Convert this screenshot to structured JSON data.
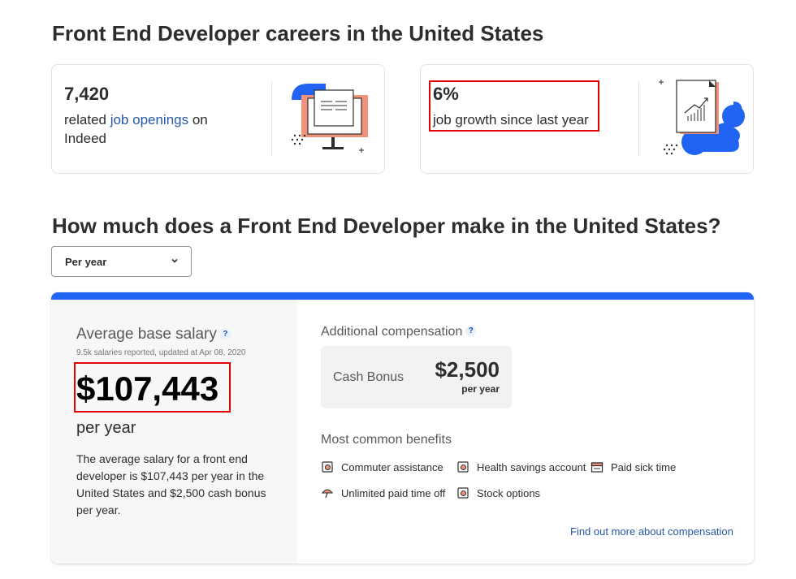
{
  "careers": {
    "title": "Front End Developer careers in the United States",
    "openings": {
      "value": "7,420",
      "text_before": "related ",
      "link": "job openings",
      "text_after": " on Indeed"
    },
    "growth": {
      "value": "6%",
      "text": "job growth since last year"
    }
  },
  "salary_section": {
    "title": "How much does a Front End Developer make in the United States?",
    "period_select": "Per year",
    "average": {
      "label": "Average base salary",
      "help": "?",
      "reported": "9.5k salaries reported, updated at Apr 08, 2020",
      "amount": "$107,443",
      "period": "per year",
      "summary": "The average salary for a front end developer is $107,443 per year in the United States and $2,500 cash bonus per year."
    },
    "additional": {
      "label": "Additional compensation",
      "help": "?",
      "bonus_label": "Cash Bonus",
      "bonus_amount": "$2,500",
      "bonus_period": "per year"
    },
    "benefits": {
      "title": "Most common benefits",
      "items": [
        "Commuter assistance",
        "Health savings account",
        "Paid sick time",
        "Unlimited paid time off",
        "Stock options"
      ]
    },
    "more_link": "Find out more about compensation"
  },
  "colors": {
    "accent_blue": "#2164f3",
    "link_blue": "#2557a7",
    "highlight_red": "#e30000",
    "illustration_orange": "#f1937a"
  }
}
